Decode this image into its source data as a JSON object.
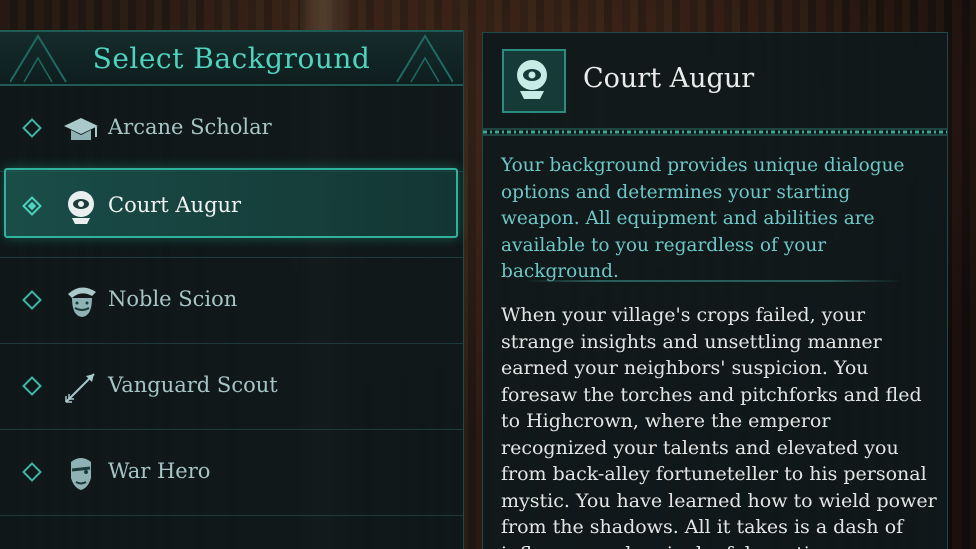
{
  "left_panel": {
    "title": "Select Background",
    "items": [
      {
        "label": "Arcane Scholar",
        "icon": "graduation-cap-icon",
        "selected": false
      },
      {
        "label": "Court Augur",
        "icon": "crystal-ball-eye-icon",
        "selected": true
      },
      {
        "label": "Noble Scion",
        "icon": "noble-face-icon",
        "selected": false
      },
      {
        "label": "Vanguard Scout",
        "icon": "arrow-icon",
        "selected": false
      },
      {
        "label": "War Hero",
        "icon": "scarred-face-icon",
        "selected": false
      }
    ]
  },
  "detail": {
    "title": "Court Augur",
    "icon": "crystal-ball-eye-icon",
    "intro": "Your background provides unique dialogue options and determines your starting weapon. All equipment and abilities are available to you regardless of your background.",
    "story": "When your village's crops failed, your strange insights and unsettling manner earned your neighbors' suspicion. You foresaw the torches and pitchforks and fled to Highcrown, where the emperor recognized your talents and elevated you from back-alley fortuneteller to his personal mystic. You have learned how to wield power from the shadows. All it takes is a dash of influence and a pinch of deception."
  },
  "colors": {
    "accent": "#4fd3bf",
    "selection": "#2fb19c",
    "intro_text": "#6ec7c8",
    "body_text": "#e3e6e4"
  }
}
